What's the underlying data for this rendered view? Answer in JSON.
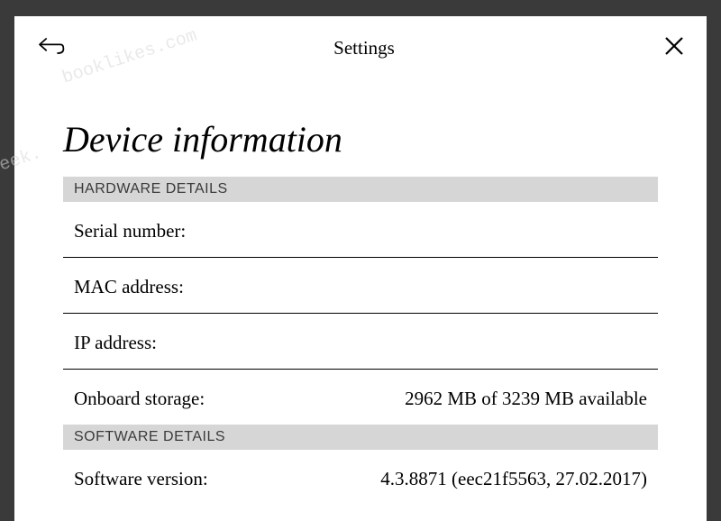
{
  "header": {
    "title": "Settings"
  },
  "page": {
    "title": "Device information"
  },
  "sections": {
    "hardware": {
      "header": "HARDWARE DETAILS",
      "serial_label": "Serial number:",
      "serial_value": "",
      "mac_label": "MAC address:",
      "mac_value": "",
      "ip_label": "IP address:",
      "ip_value": "",
      "storage_label": "Onboard storage:",
      "storage_value": "2962 MB of 3239 MB available"
    },
    "software": {
      "header": "SOFTWARE DETAILS",
      "version_label": "Software version:",
      "version_value": "4.3.8871 (eec21f5563, 27.02.2017)"
    }
  },
  "watermark": {
    "line1": "booklikes.com",
    "line2": "cubgeek."
  }
}
